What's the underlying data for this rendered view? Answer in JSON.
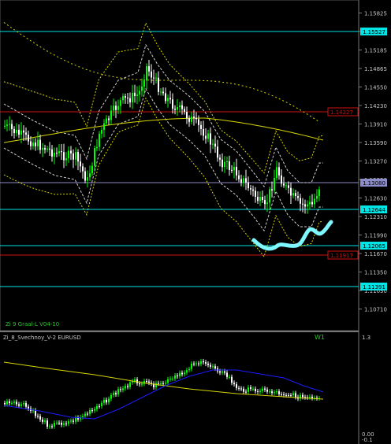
{
  "main_panel": {
    "indicator_label": "Zi 9 Graal-L V04-10",
    "price_axis_ticks": [
      "1.15825",
      "1.15505",
      "1.15185",
      "1.14865",
      "1.14550",
      "1.14230",
      "1.13910",
      "1.13590",
      "1.13270",
      "1.12950",
      "1.12630",
      "1.12310",
      "1.11990",
      "1.11670",
      "1.11350",
      "1.11030",
      "1.10710"
    ],
    "horizontal_levels": [
      {
        "label": "1.15527",
        "color": "#00e5e5"
      },
      {
        "label": "1.14227",
        "color": "#d01010"
      },
      {
        "label": "1.13080",
        "color": "#8c8cc8"
      },
      {
        "label": "1.12644",
        "color": "#00e5e5"
      },
      {
        "label": "1.12065",
        "color": "#00e5e5"
      },
      {
        "label": "1.11917",
        "color": "#d01010"
      },
      {
        "label": "1.11391",
        "color": "#00e5e5"
      }
    ],
    "colors": {
      "bull_candle": "#00ff00",
      "bear_candle": "#ffffff",
      "ma_yellow": "#d6d600",
      "band_white": "#cfcfcf",
      "annotation": "#7ff7ff"
    }
  },
  "sub_panel": {
    "title": "Zi_8_Svechnoy_V-2 EURUSD",
    "timeframe": "W1",
    "axis_top": "1.3",
    "axis_bottom_1": "0.00",
    "axis_bottom_2": "-0.1",
    "colors": {
      "bull_candle": "#00ff00",
      "bear_candle": "#ffffff",
      "line_blue": "#1c1cff",
      "line_yellow": "#d6d600"
    }
  }
}
